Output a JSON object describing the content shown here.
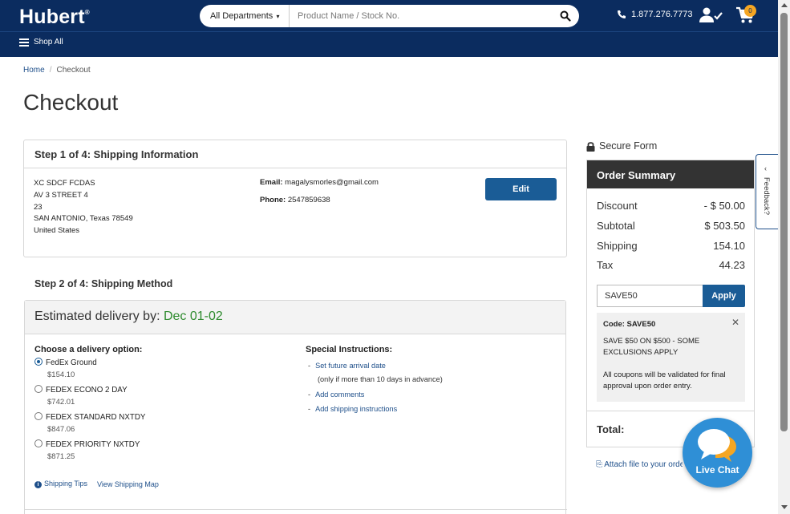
{
  "header": {
    "logo": "Hubert",
    "logo_mark": "®",
    "department_label": "All Departments",
    "search_placeholder": "Product Name / Stock No.",
    "phone": "1.877.276.7773",
    "cart_count": "0",
    "shop_all": "Shop All"
  },
  "breadcrumb": {
    "home": "Home",
    "sep": "/",
    "current": "Checkout"
  },
  "page_title": "Checkout",
  "step1": {
    "title": "Step 1 of 4: Shipping Information",
    "address": [
      "XC SDCF FCDAS",
      "AV 3 STREET 4",
      "23",
      "SAN ANTONIO, Texas 78549",
      "United States"
    ],
    "email_label": "Email:",
    "email": "magalysmorles@gmail.com",
    "phone_label": "Phone:",
    "phone": "2547859638",
    "edit_label": "Edit"
  },
  "step2": {
    "title": "Step 2 of 4: Shipping Method",
    "est_prefix": "Estimated delivery by:",
    "est_date": "Dec 01-02",
    "choose_label": "Choose a delivery option:",
    "options": [
      {
        "name": "FedEx Ground",
        "price": "$154.10",
        "selected": true
      },
      {
        "name": "FEDEX ECONO 2 DAY",
        "price": "$742.01",
        "selected": false
      },
      {
        "name": "FEDEX STANDARD NXTDY",
        "price": "$847.06",
        "selected": false
      },
      {
        "name": "FEDEX PRIORITY NXTDY",
        "price": "$871.25",
        "selected": false
      }
    ],
    "shipping_tips": "Shipping Tips",
    "view_map": "View Shipping Map",
    "special_label": "Special Instructions:",
    "future_date": "Set future arrival date",
    "future_note": "(only if more than 10 days in advance)",
    "add_comments": "Add comments",
    "add_shipping": "Add shipping instructions"
  },
  "summary": {
    "secure": "Secure Form",
    "title": "Order Summary",
    "discount_label": "Discount",
    "discount": "- $ 50.00",
    "subtotal_label": "Subtotal",
    "subtotal": "$ 503.50",
    "shipping_label": "Shipping",
    "shipping": "154.10",
    "tax_label": "Tax",
    "tax": "44.23",
    "coupon_value": "SAVE50",
    "apply_label": "Apply",
    "coupon_code": "Code: SAVE50",
    "coupon_desc": "SAVE $50 ON $500 - SOME EXCLUSIONS APPLY",
    "coupon_note": "All coupons will be validated for final approval upon order entry.",
    "total_label": "Total:",
    "attach": "Attach file to your order"
  },
  "feedback": "Feedback?",
  "livechat": "Live Chat"
}
